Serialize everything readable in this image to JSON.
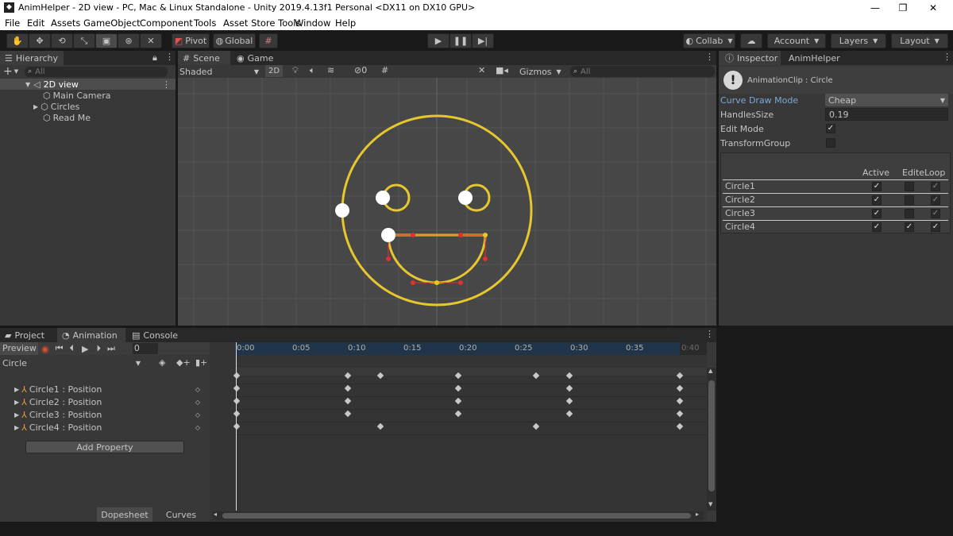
{
  "window": {
    "title": "AnimHelper - 2D view - PC, Mac & Linux Standalone - Unity 2019.4.13f1 Personal <DX11 on DX10 GPU>",
    "minimize": "—",
    "maximize": "❐",
    "close": "✕"
  },
  "menu": [
    "File",
    "Edit",
    "Assets",
    "GameObject",
    "Component",
    "Tools",
    "Asset Store Tools",
    "Window",
    "Help"
  ],
  "toolbar": {
    "pivot": "Pivot",
    "global": "Global",
    "collab": "Collab",
    "account": "Account",
    "layers": "Layers",
    "layout": "Layout"
  },
  "hierarchy": {
    "tab": "Hierarchy",
    "search_placeholder": "All",
    "items": [
      "2D view",
      "Main Camera",
      "Circles",
      "Read Me"
    ]
  },
  "scene": {
    "tabs": [
      "Scene",
      "Game"
    ],
    "shading": "Shaded",
    "mode_2d": "2D",
    "hidden_count": "0",
    "gizmos": "Gizmos",
    "search_placeholder": "All"
  },
  "inspector": {
    "tabs": [
      "Inspector",
      "AnimHelper"
    ],
    "asset_name": "AnimationClip : Circle",
    "fields": {
      "curve_draw_mode": {
        "label": "Curve Draw Mode",
        "value": "Cheap"
      },
      "handles_size": {
        "label": "HandlesSize",
        "value": "0.19"
      },
      "edit_mode": {
        "label": "Edit Mode",
        "checked": true
      },
      "transform_group": {
        "label": "TransformGroup",
        "checked": false
      }
    },
    "table": {
      "headers": [
        "Active",
        "Edite",
        "Loop"
      ],
      "rows": [
        {
          "name": "Circle1",
          "active": true,
          "edite": false,
          "loop": true
        },
        {
          "name": "Circle2",
          "active": true,
          "edite": false,
          "loop": true
        },
        {
          "name": "Circle3",
          "active": true,
          "edite": false,
          "loop": true
        },
        {
          "name": "Circle4",
          "active": true,
          "edite": true,
          "loop": true
        }
      ]
    }
  },
  "animation": {
    "tabs": [
      "Project",
      "Animation",
      "Console"
    ],
    "preview": "Preview",
    "frame": "0",
    "clip": "Circle",
    "tracks": [
      "Circle1 : Position",
      "Circle2 : Position",
      "Circle3 : Position",
      "Circle4 : Position"
    ],
    "add_property": "Add Property",
    "time_ticks": [
      "0:00",
      "0:05",
      "0:10",
      "0:15",
      "0:20",
      "0:25",
      "0:30",
      "0:35",
      "0:40"
    ],
    "keyframes": {
      "summary": [
        0,
        10,
        13,
        20,
        27,
        30,
        40
      ],
      "circle1": [
        0,
        10,
        20,
        30,
        40
      ],
      "circle2": [
        0,
        10,
        20,
        30,
        40
      ],
      "circle3": [
        0,
        10,
        20,
        30,
        40
      ],
      "circle4": [
        0,
        13,
        27,
        40
      ]
    },
    "view_tabs": [
      "Dopesheet",
      "Curves"
    ]
  },
  "colors": {
    "accent": "#e6c72e",
    "selection": "#2c5d87",
    "link_label": "#7fa8d8"
  }
}
